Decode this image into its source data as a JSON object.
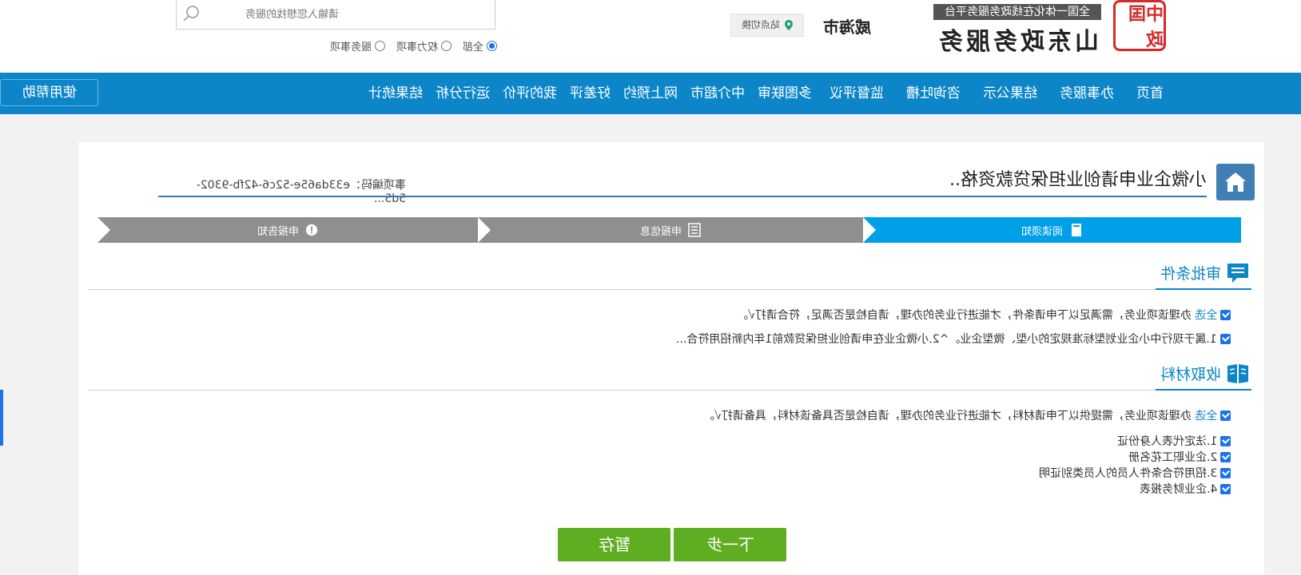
{
  "header": {
    "logo_seal": "中国政",
    "logo_sub": "全国一体化在线政务服务平台",
    "logo_main": "山东政务服务",
    "city": "威海市",
    "site_switch": "站点切换",
    "search_placeholder": "请输入您想找的服务",
    "radios": [
      {
        "label": "全部",
        "checked": true
      },
      {
        "label": "权力事项",
        "checked": false
      },
      {
        "label": "服务事项",
        "checked": false
      }
    ]
  },
  "nav": {
    "items": [
      "首页",
      "办事服务",
      "结果公示",
      "咨询吐槽",
      "监督评议",
      "多图联审",
      "中介超市",
      "网上预约",
      "好差评",
      "我的评价",
      "运行分析",
      "结果统计"
    ],
    "help": "使用帮助"
  },
  "main": {
    "title": "小微企业申请创业担保贷款资格..",
    "item_code": "事项编码：e33da65e-52c6-42fb-9302-5d5...",
    "steps": [
      "阅读须知",
      "申报信息",
      "申报告知"
    ],
    "conditions": {
      "title": "审批条件",
      "select_all": "全选",
      "intro": "办理该项业务，需满足以下申请条件，才能进行业务的办理，请自检是否满足，符合请打√。",
      "items": [
        "1.属于现行中小企业划型标准规定的小型、微型企业。^2.小微企业在申请创业担保贷款前1年内新招用符合..."
      ]
    },
    "materials": {
      "title": "收取材料",
      "select_all": "全选",
      "intro": "办理该项业务，需提供以下申请材料，才能进行业务的办理，请自检是否具备该材料，具备请打√。",
      "items": [
        "1.法定代表人身份证",
        "2.企业职工花名册",
        "3.招用符合条件人员的人员类别证明",
        "4.企业财务报表"
      ]
    },
    "buttons": {
      "next": "下一步",
      "save": "暂存"
    }
  },
  "colors": {
    "nav_blue": "#0c86c8",
    "step_active": "#00a0e9",
    "step_gray": "#8f8f8f",
    "button_green": "#5fae22",
    "seal_red": "#d42a2a"
  }
}
